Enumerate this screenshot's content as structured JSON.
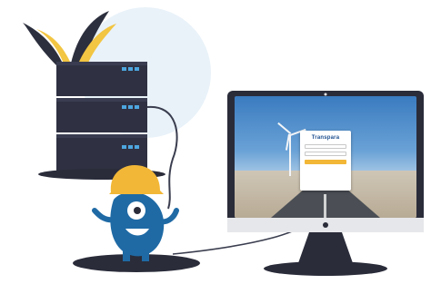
{
  "illustration": {
    "colors": {
      "blob": "#e9f2f9",
      "server": "#2f3142",
      "server_light": "#3a3d51",
      "server_led": "#4da6df",
      "hard_hat": "#f2b737",
      "mascot": "#1f6aa5",
      "monitor": "#2a2c3a",
      "monitor_frame": "#e6e7ea",
      "cable": "#3a3d4e",
      "leaves_dark": "#2c2f3d",
      "leaves_yellow": "#f2c542"
    },
    "server_units": 3,
    "monitor_screen": {
      "login_panel": {
        "logo_text": "Transpara",
        "heading_text": "",
        "body_text": "",
        "fields": [
          "",
          ""
        ],
        "button_color": "#f2b737"
      }
    }
  }
}
